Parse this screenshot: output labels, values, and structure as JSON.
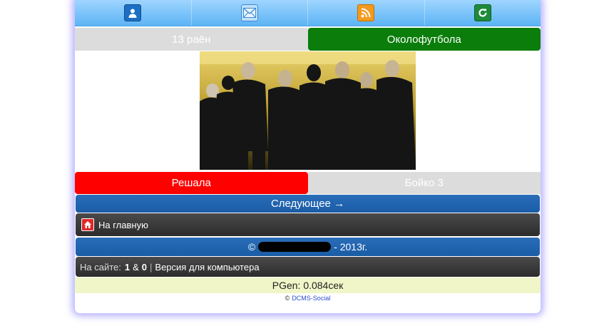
{
  "topbar": {
    "icons": [
      {
        "name": "profile-icon",
        "color": "#1b6fc4"
      },
      {
        "name": "mail-icon",
        "color": "#6ab2f0"
      },
      {
        "name": "rss-icon",
        "color": "#f39a1e"
      },
      {
        "name": "refresh-icon",
        "color": "#1e8a3a"
      }
    ]
  },
  "nav_top": {
    "prev": "13 раён",
    "next": "Околофутбола"
  },
  "nav_bottom": {
    "prev": "Решала",
    "next": "Бойко 3"
  },
  "next_button": "Следующее →",
  "home_link": "На главную",
  "copyright": {
    "prefix": "©",
    "suffix": "- 2013г."
  },
  "online": {
    "label": "На сайте:",
    "users": "1",
    "amp": "&",
    "guests": "0",
    "separator": "|",
    "desktop_link": "Версия для компьютера"
  },
  "pgen": "PGen: 0.084сек",
  "credits": {
    "symbol": "©",
    "link": "DCMS-Social"
  },
  "colors": {
    "green": "#0a7d0a",
    "red": "#ff0000",
    "blue": "#1a5ca6",
    "dark": "#333333",
    "grey": "#dcdcdc"
  }
}
